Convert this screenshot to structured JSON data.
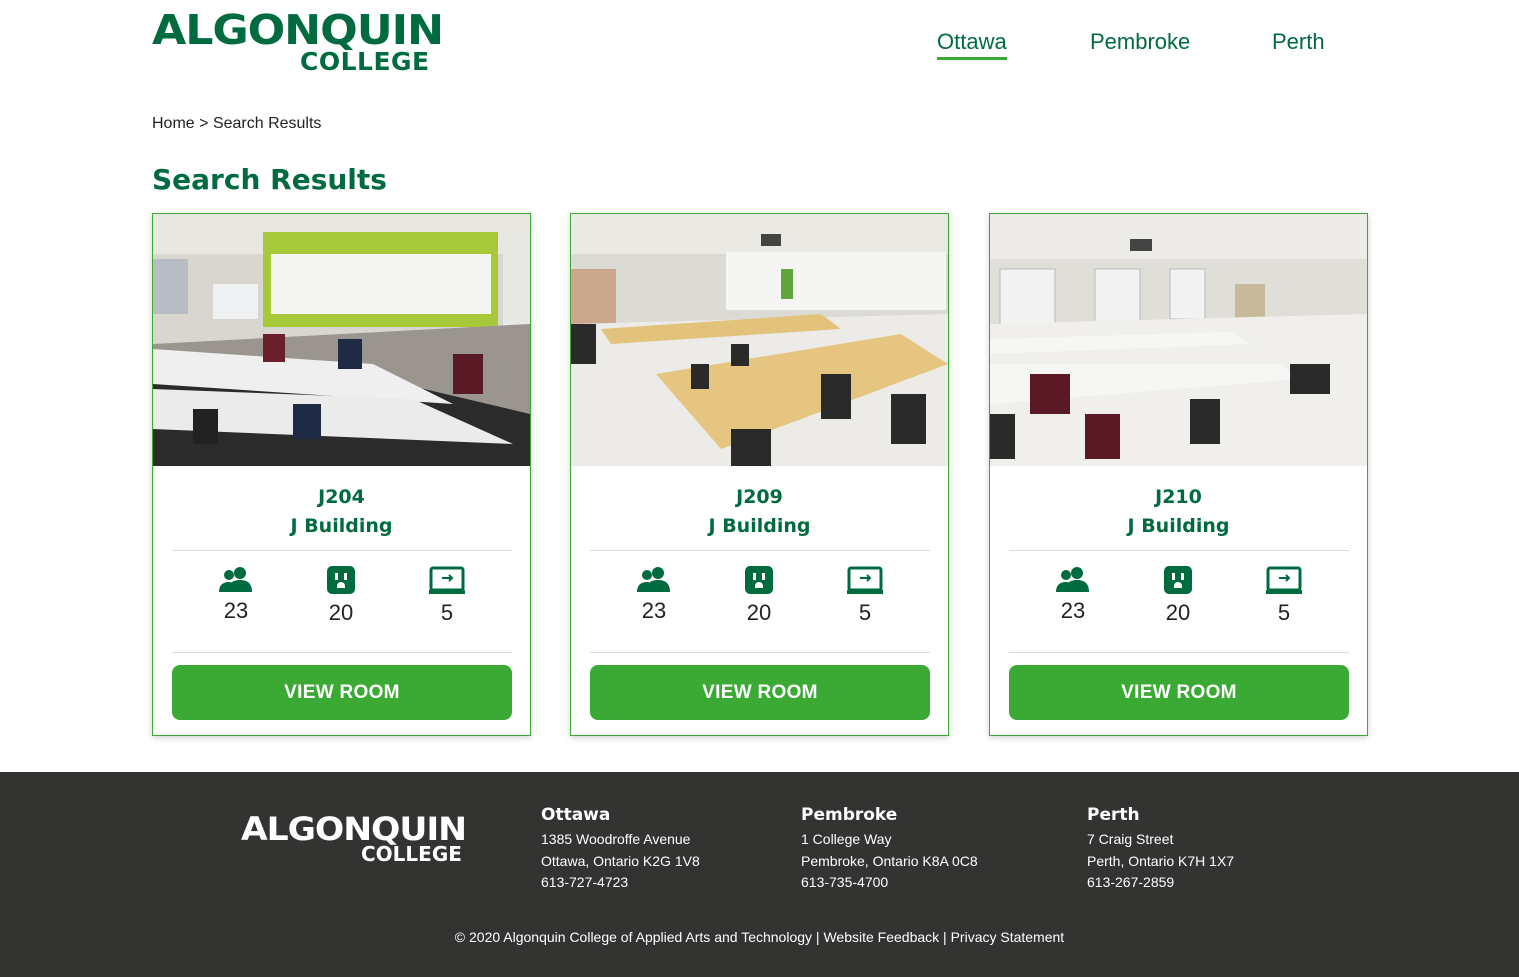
{
  "brand": {
    "line1": "ALGONQUIN",
    "line2": "COLLEGE",
    "primary_color": "#006b3f",
    "accent_color": "#3aaa35",
    "footer_bg": "#333332"
  },
  "nav": {
    "items": [
      {
        "label": "Ottawa",
        "active": true
      },
      {
        "label": "Pembroke",
        "active": false
      },
      {
        "label": "Perth",
        "active": false
      }
    ]
  },
  "breadcrumb": {
    "home": "Home",
    "separator": ">",
    "current": "Search Results"
  },
  "page": {
    "title": "Search Results"
  },
  "cards": [
    {
      "room": "J204",
      "building": "J Building",
      "capacity": "23",
      "outlets": "20",
      "computers": "5",
      "button": "VIEW ROOM",
      "photo": "classroom-photo-lime-wall"
    },
    {
      "room": "J209",
      "building": "J Building",
      "capacity": "23",
      "outlets": "20",
      "computers": "5",
      "button": "VIEW ROOM",
      "photo": "classroom-photo-wood-tables"
    },
    {
      "room": "J210",
      "building": "J Building",
      "capacity": "23",
      "outlets": "20",
      "computers": "5",
      "button": "VIEW ROOM",
      "photo": "classroom-photo-white-tables"
    }
  ],
  "icons": {
    "capacity": "people-icon",
    "outlets": "power-outlet-icon",
    "computers": "monitor-icon"
  },
  "footer": {
    "campuses": [
      {
        "name": "Ottawa",
        "address1": "1385 Woodroffe Avenue",
        "address2": "Ottawa, Ontario K2G 1V8",
        "phone": "613-727-4723"
      },
      {
        "name": "Pembroke",
        "address1": "1 College Way",
        "address2": "Pembroke, Ontario K8A 0C8",
        "phone": "613-735-4700"
      },
      {
        "name": "Perth",
        "address1": "7 Craig Street",
        "address2": "Perth, Ontario K7H 1X7",
        "phone": "613-267-2859"
      }
    ],
    "copyright_symbol": "©",
    "copyright": "2020 Algonquin College of Applied Arts and Technology",
    "sep": "|",
    "feedback": "Website Feedback",
    "privacy": "Privacy Statement"
  }
}
